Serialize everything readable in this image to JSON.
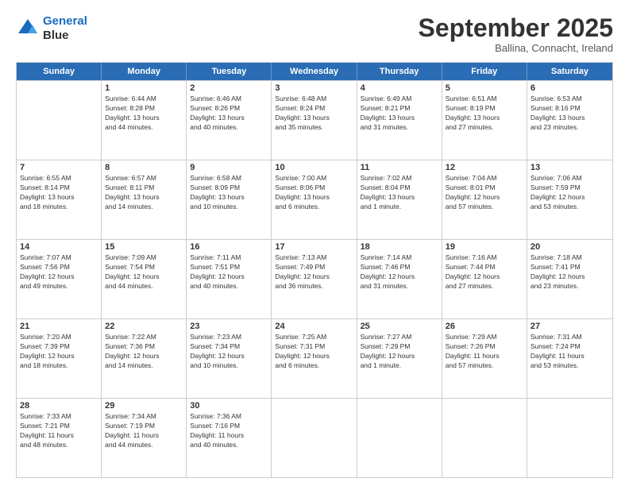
{
  "logo": {
    "line1": "General",
    "line2": "Blue"
  },
  "title": "September 2025",
  "location": "Ballina, Connacht, Ireland",
  "days_header": [
    "Sunday",
    "Monday",
    "Tuesday",
    "Wednesday",
    "Thursday",
    "Friday",
    "Saturday"
  ],
  "weeks": [
    [
      {
        "day": "",
        "info": ""
      },
      {
        "day": "1",
        "info": "Sunrise: 6:44 AM\nSunset: 8:28 PM\nDaylight: 13 hours\nand 44 minutes."
      },
      {
        "day": "2",
        "info": "Sunrise: 6:46 AM\nSunset: 8:26 PM\nDaylight: 13 hours\nand 40 minutes."
      },
      {
        "day": "3",
        "info": "Sunrise: 6:48 AM\nSunset: 8:24 PM\nDaylight: 13 hours\nand 35 minutes."
      },
      {
        "day": "4",
        "info": "Sunrise: 6:49 AM\nSunset: 8:21 PM\nDaylight: 13 hours\nand 31 minutes."
      },
      {
        "day": "5",
        "info": "Sunrise: 6:51 AM\nSunset: 8:19 PM\nDaylight: 13 hours\nand 27 minutes."
      },
      {
        "day": "6",
        "info": "Sunrise: 6:53 AM\nSunset: 8:16 PM\nDaylight: 13 hours\nand 23 minutes."
      }
    ],
    [
      {
        "day": "7",
        "info": "Sunrise: 6:55 AM\nSunset: 8:14 PM\nDaylight: 13 hours\nand 18 minutes."
      },
      {
        "day": "8",
        "info": "Sunrise: 6:57 AM\nSunset: 8:11 PM\nDaylight: 13 hours\nand 14 minutes."
      },
      {
        "day": "9",
        "info": "Sunrise: 6:58 AM\nSunset: 8:09 PM\nDaylight: 13 hours\nand 10 minutes."
      },
      {
        "day": "10",
        "info": "Sunrise: 7:00 AM\nSunset: 8:06 PM\nDaylight: 13 hours\nand 6 minutes."
      },
      {
        "day": "11",
        "info": "Sunrise: 7:02 AM\nSunset: 8:04 PM\nDaylight: 13 hours\nand 1 minute."
      },
      {
        "day": "12",
        "info": "Sunrise: 7:04 AM\nSunset: 8:01 PM\nDaylight: 12 hours\nand 57 minutes."
      },
      {
        "day": "13",
        "info": "Sunrise: 7:06 AM\nSunset: 7:59 PM\nDaylight: 12 hours\nand 53 minutes."
      }
    ],
    [
      {
        "day": "14",
        "info": "Sunrise: 7:07 AM\nSunset: 7:56 PM\nDaylight: 12 hours\nand 49 minutes."
      },
      {
        "day": "15",
        "info": "Sunrise: 7:09 AM\nSunset: 7:54 PM\nDaylight: 12 hours\nand 44 minutes."
      },
      {
        "day": "16",
        "info": "Sunrise: 7:11 AM\nSunset: 7:51 PM\nDaylight: 12 hours\nand 40 minutes."
      },
      {
        "day": "17",
        "info": "Sunrise: 7:13 AM\nSunset: 7:49 PM\nDaylight: 12 hours\nand 36 minutes."
      },
      {
        "day": "18",
        "info": "Sunrise: 7:14 AM\nSunset: 7:46 PM\nDaylight: 12 hours\nand 31 minutes."
      },
      {
        "day": "19",
        "info": "Sunrise: 7:16 AM\nSunset: 7:44 PM\nDaylight: 12 hours\nand 27 minutes."
      },
      {
        "day": "20",
        "info": "Sunrise: 7:18 AM\nSunset: 7:41 PM\nDaylight: 12 hours\nand 23 minutes."
      }
    ],
    [
      {
        "day": "21",
        "info": "Sunrise: 7:20 AM\nSunset: 7:39 PM\nDaylight: 12 hours\nand 18 minutes."
      },
      {
        "day": "22",
        "info": "Sunrise: 7:22 AM\nSunset: 7:36 PM\nDaylight: 12 hours\nand 14 minutes."
      },
      {
        "day": "23",
        "info": "Sunrise: 7:23 AM\nSunset: 7:34 PM\nDaylight: 12 hours\nand 10 minutes."
      },
      {
        "day": "24",
        "info": "Sunrise: 7:25 AM\nSunset: 7:31 PM\nDaylight: 12 hours\nand 6 minutes."
      },
      {
        "day": "25",
        "info": "Sunrise: 7:27 AM\nSunset: 7:29 PM\nDaylight: 12 hours\nand 1 minute."
      },
      {
        "day": "26",
        "info": "Sunrise: 7:29 AM\nSunset: 7:26 PM\nDaylight: 11 hours\nand 57 minutes."
      },
      {
        "day": "27",
        "info": "Sunrise: 7:31 AM\nSunset: 7:24 PM\nDaylight: 11 hours\nand 53 minutes."
      }
    ],
    [
      {
        "day": "28",
        "info": "Sunrise: 7:33 AM\nSunset: 7:21 PM\nDaylight: 11 hours\nand 48 minutes."
      },
      {
        "day": "29",
        "info": "Sunrise: 7:34 AM\nSunset: 7:19 PM\nDaylight: 11 hours\nand 44 minutes."
      },
      {
        "day": "30",
        "info": "Sunrise: 7:36 AM\nSunset: 7:16 PM\nDaylight: 11 hours\nand 40 minutes."
      },
      {
        "day": "",
        "info": ""
      },
      {
        "day": "",
        "info": ""
      },
      {
        "day": "",
        "info": ""
      },
      {
        "day": "",
        "info": ""
      }
    ]
  ]
}
